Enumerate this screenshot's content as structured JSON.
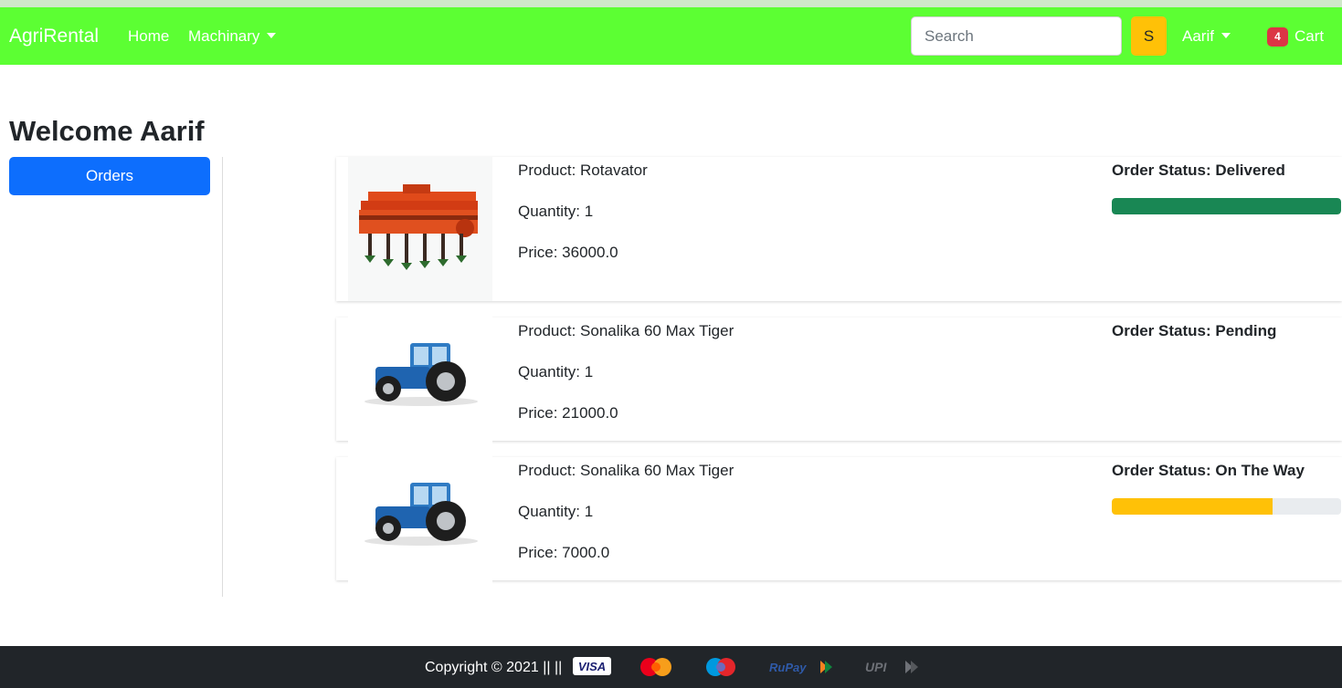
{
  "navbar": {
    "brand": "AgriRental",
    "home_label": "Home",
    "machinary_label": "Machinary",
    "search_placeholder": "Search",
    "search_button_label": "S",
    "user_label": "Aarif",
    "cart_count": "4",
    "cart_label": "Cart",
    "bg_color": "#5cff33"
  },
  "page": {
    "welcome": "Welcome Aarif"
  },
  "sidebar": {
    "orders_label": "Orders"
  },
  "orders": [
    {
      "image_icon": "rotavator-machine-image",
      "product": "Product: Rotavator",
      "quantity": "Quantity: 1",
      "price": "Price: 36000.0",
      "status": "Order Status: Delivered",
      "progress": 1.0,
      "progress_color": "#198754"
    },
    {
      "image_icon": "tractor-image",
      "product": "Product: Sonalika 60 Max Tiger",
      "quantity": "Quantity: 1",
      "price": "Price: 21000.0",
      "status": "Order Status: Pending",
      "progress": null,
      "progress_color": null
    },
    {
      "image_icon": "tractor-image",
      "product": "Product: Sonalika 60 Max Tiger",
      "quantity": "Quantity: 1",
      "price": "Price: 7000.0",
      "status": "Order Status: On The Way",
      "progress": 0.7,
      "progress_color": "#ffc107"
    }
  ],
  "footer": {
    "copyright": "Copyright © 2021 || ||",
    "payment_logos": [
      "visa-logo",
      "mastercard-logo",
      "maestro-logo",
      "rupay-logo",
      "upi-logo"
    ]
  }
}
